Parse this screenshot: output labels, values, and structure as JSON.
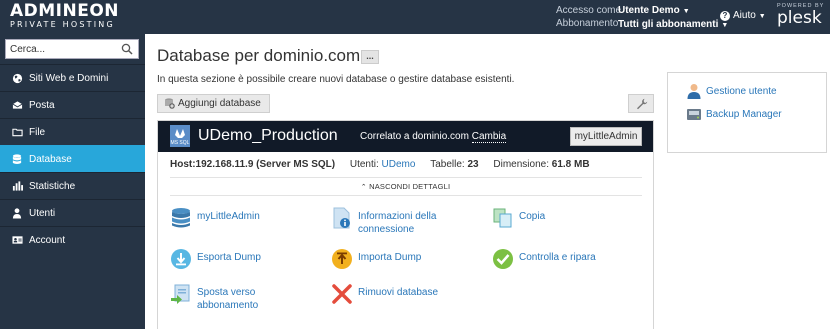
{
  "brand": {
    "name": "ADMINEON",
    "tagline": "PRIVATE HOSTING"
  },
  "topbar": {
    "access_label": "Accesso come",
    "access_value": "Utente Demo",
    "subscription_label": "Abbonamento",
    "subscription_value": "Tutti gli abbonamenti",
    "help_label": "Aiuto",
    "powered_by": "POWERED BY",
    "powered_name": "plesk"
  },
  "sidebar": {
    "search_placeholder": "Cerca...",
    "items": [
      {
        "label": "Siti Web e Domini",
        "icon": "globe-icon"
      },
      {
        "label": "Posta",
        "icon": "mail-icon"
      },
      {
        "label": "File",
        "icon": "folder-icon"
      },
      {
        "label": "Database",
        "icon": "database-icon",
        "active": true
      },
      {
        "label": "Statistiche",
        "icon": "bar-chart-icon"
      },
      {
        "label": "Utenti",
        "icon": "user-icon"
      },
      {
        "label": "Account",
        "icon": "account-card-icon"
      }
    ]
  },
  "main": {
    "title": "Database per dominio.com",
    "title_more": "...",
    "description": "In questa sezione è possibile creare nuovi database o gestire database esistenti.",
    "add_button": "Aggiungi database"
  },
  "database": {
    "type_badge": "MS SQL",
    "name": "UDemo_Production",
    "linked_prefix": "Correlato a dominio.com",
    "change_link": "Cambia",
    "admin_button": "myLittleAdmin",
    "host": "Host:192.168.11.9 (Server MS SQL)",
    "users_label": "Utenti:",
    "users_value": "UDemo",
    "tables_label": "Tabelle:",
    "tables_value": "23",
    "size_label": "Dimensione:",
    "size_value": "61.8 MB",
    "toggle_label": "NASCONDI DETTAGLI",
    "tools": [
      {
        "label": "myLittleAdmin",
        "icon": "database-stack-icon"
      },
      {
        "label": "Informazioni della connessione",
        "icon": "connection-info-icon"
      },
      {
        "label": "Copia",
        "icon": "copy-icon"
      },
      {
        "label": "Esporta Dump",
        "icon": "export-dump-icon"
      },
      {
        "label": "Importa Dump",
        "icon": "import-dump-icon"
      },
      {
        "label": "Controlla e ripara",
        "icon": "check-repair-icon"
      },
      {
        "label": "Sposta verso abbonamento",
        "icon": "move-subscription-icon"
      },
      {
        "label": "Rimuovi database",
        "icon": "remove-icon"
      }
    ]
  },
  "right_panel": {
    "items": [
      {
        "label": "Gestione utente",
        "icon": "user-management-icon"
      },
      {
        "label": "Backup Manager",
        "icon": "backup-manager-icon"
      }
    ]
  },
  "colors": {
    "topbar_bg": "#263445",
    "active_nav": "#28a7da",
    "db_header_bg": "#111a28",
    "link": "#2a77b9"
  }
}
